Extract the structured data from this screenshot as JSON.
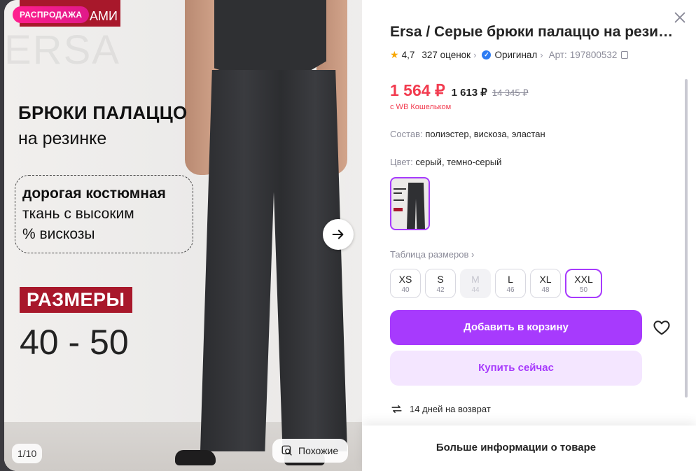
{
  "gallery": {
    "sale_badge": "РАСПРОДАЖА",
    "brand_tab": "АМИ",
    "watermark": "ERSA",
    "headline": "БРЮКИ ПАЛАЦЦО",
    "subheadline": "на резинке",
    "features": [
      "дорогая костюмная",
      "ткань с высоким",
      "% вискозы"
    ],
    "sizes_label": "РАЗМЕРЫ",
    "sizes_range": "40 - 50",
    "counter": "1/10",
    "similar_label": "Похожие"
  },
  "product": {
    "title": "Ersa / Серые брюки палаццо на резинке",
    "rating": "4,7",
    "reviews": "327 оценок",
    "original": "Оригинал",
    "article_label": "Арт:",
    "article": "197800532",
    "price": "1 564 ₽",
    "price_alt": "1 613 ₽",
    "price_old": "14 345 ₽",
    "wallet_note": "с WB Кошельком",
    "composition_label": "Состав:",
    "composition": "полиэстер, вискоза, эластан",
    "color_label": "Цвет:",
    "color": "серый, темно-серый",
    "size_table": "Таблица размеров",
    "sizes": [
      {
        "size": "XS",
        "ru": "40",
        "state": "available"
      },
      {
        "size": "S",
        "ru": "42",
        "state": "available"
      },
      {
        "size": "M",
        "ru": "44",
        "state": "disabled"
      },
      {
        "size": "L",
        "ru": "46",
        "state": "available"
      },
      {
        "size": "XL",
        "ru": "48",
        "state": "available"
      },
      {
        "size": "XXL",
        "ru": "50",
        "state": "selected"
      }
    ],
    "add_to_cart": "Добавить в корзину",
    "buy_now": "Купить сейчас",
    "returns": "14 дней на возврат",
    "more_info": "Больше информации о товаре"
  },
  "icons": [
    "close-icon",
    "star-icon",
    "verified-icon",
    "copy-icon",
    "arrow-right-icon",
    "search-similar-icon",
    "heart-icon",
    "return-arrows-icon"
  ],
  "colors": {
    "accent": "#a73afd",
    "accent_light": "#f4e6ff",
    "price": "#f23b4f",
    "sale": "#ff1f8e",
    "brand": "#a8182b"
  }
}
